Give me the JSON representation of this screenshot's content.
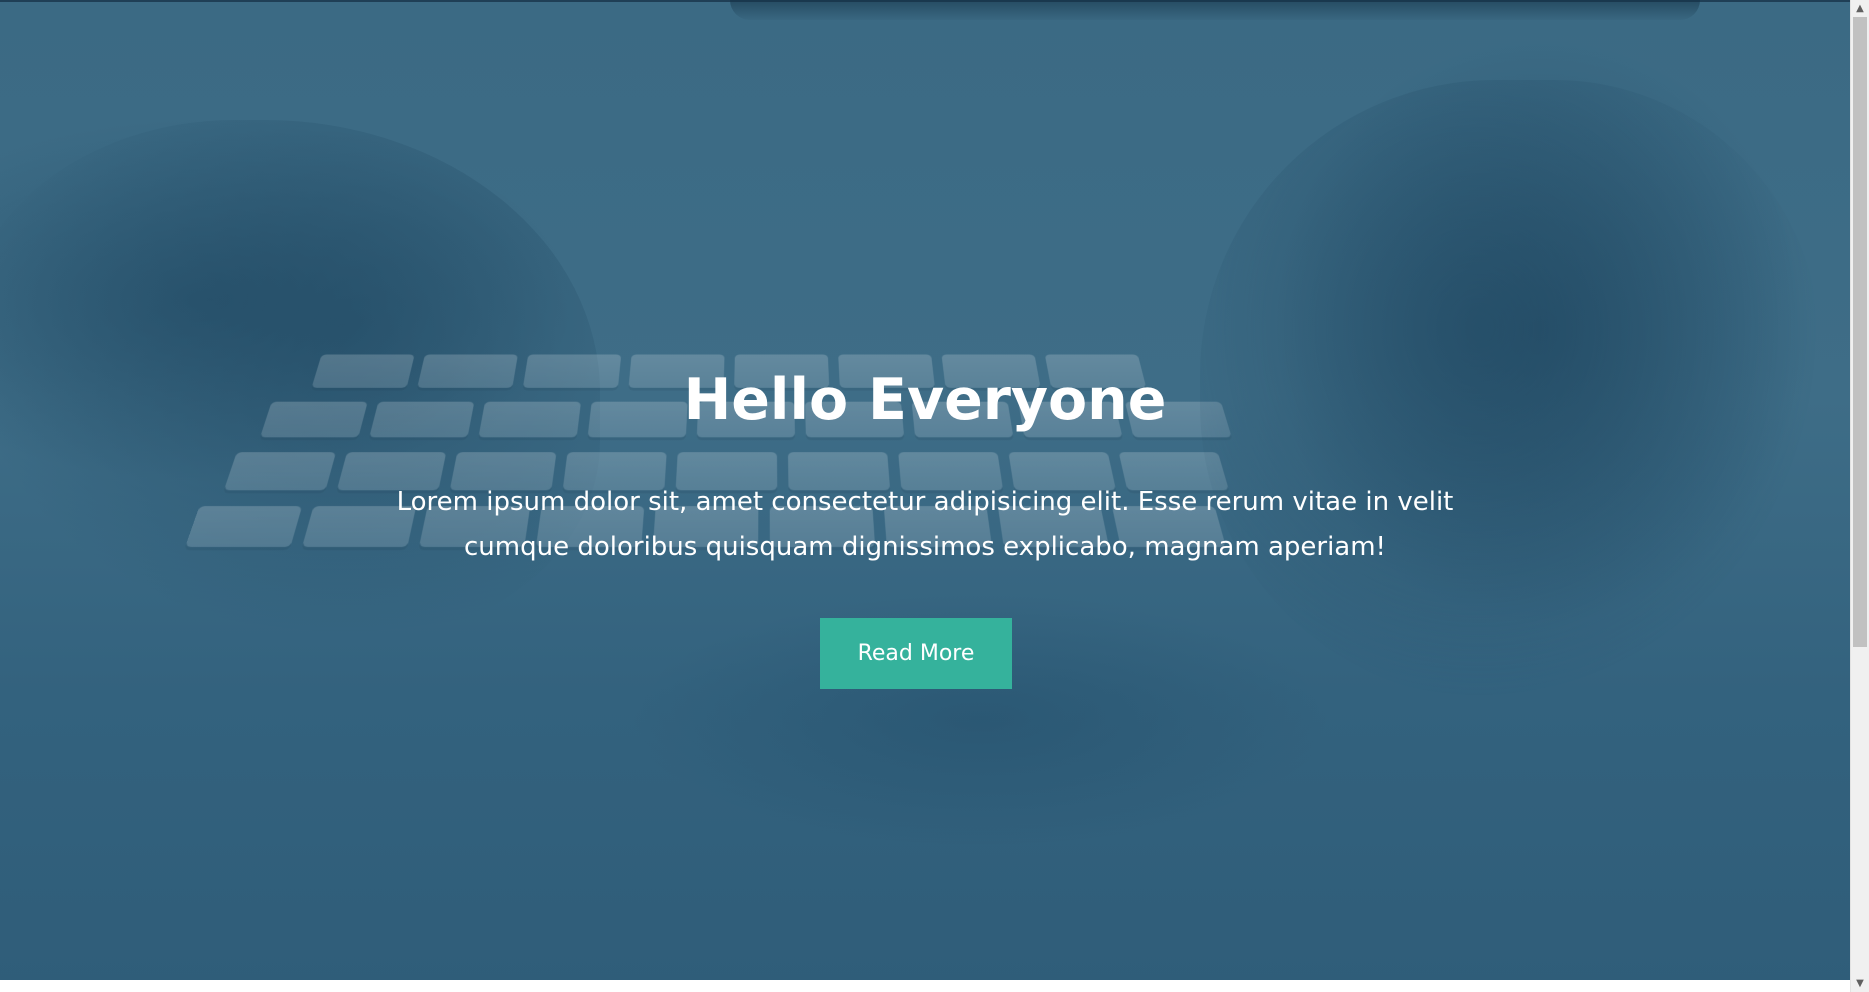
{
  "hero": {
    "title": "Hello Everyone",
    "text": "Lorem ipsum dolor sit, amet consectetur adipisicing elit. Esse rerum vitae in velit cumque doloribus quisquam dignissimos explicabo, magnam aperiam!",
    "button_label": "Read More"
  },
  "colors": {
    "overlay": "#3b6a84",
    "button": "#35b29c",
    "text": "#ffffff"
  },
  "scrollbar": {
    "up_icon": "chevron-up-icon",
    "down_icon": "chevron-down-icon",
    "up_glyph": "▲",
    "down_glyph": "▼"
  },
  "background_image": "keyboard-typing-photo"
}
